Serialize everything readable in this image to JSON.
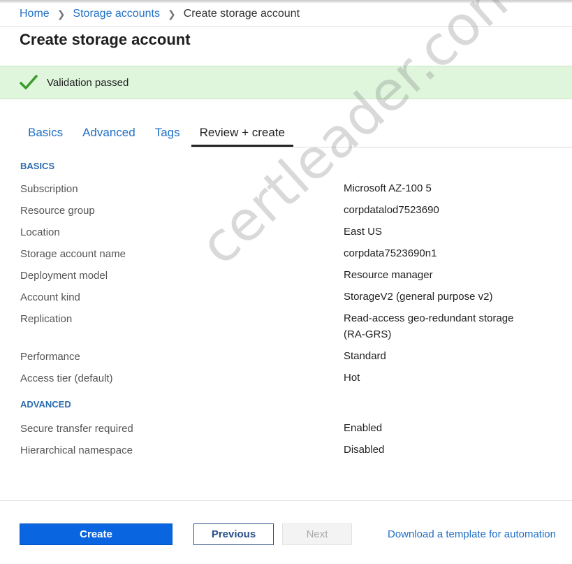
{
  "breadcrumb": {
    "home": "Home",
    "storage_accounts": "Storage accounts",
    "current": "Create storage account"
  },
  "page_title": "Create storage account",
  "banner": {
    "message": "Validation passed"
  },
  "tabs": [
    {
      "label": "Basics"
    },
    {
      "label": "Advanced"
    },
    {
      "label": "Tags"
    },
    {
      "label": "Review + create"
    }
  ],
  "sections": {
    "basics": "BASICS",
    "advanced": "ADVANCED"
  },
  "basics": [
    {
      "label": "Subscription",
      "value": "Microsoft AZ-100 5"
    },
    {
      "label": "Resource group",
      "value": "corpdatalod7523690"
    },
    {
      "label": "Location",
      "value": "East US"
    },
    {
      "label": "Storage account name",
      "value": "corpdata7523690n1"
    },
    {
      "label": "Deployment model",
      "value": "Resource manager"
    },
    {
      "label": "Account kind",
      "value": "StorageV2 (general purpose v2)"
    },
    {
      "label": "Replication",
      "value": "Read-access geo-redundant storage (RA-GRS)"
    },
    {
      "label": "Performance",
      "value": "Standard"
    },
    {
      "label": "Access tier (default)",
      "value": "Hot"
    }
  ],
  "advanced": [
    {
      "label": "Secure transfer required",
      "value": "Enabled"
    },
    {
      "label": "Hierarchical namespace",
      "value": "Disabled"
    }
  ],
  "footer": {
    "create": "Create",
    "previous": "Previous",
    "next": "Next",
    "download_template": "Download a template for automation"
  },
  "watermark": "certleader.com",
  "colors": {
    "link": "#1f6fc5",
    "success_bg": "#dff6dd",
    "success_check": "#3a9a2a",
    "primary_button": "#0a66e0"
  }
}
